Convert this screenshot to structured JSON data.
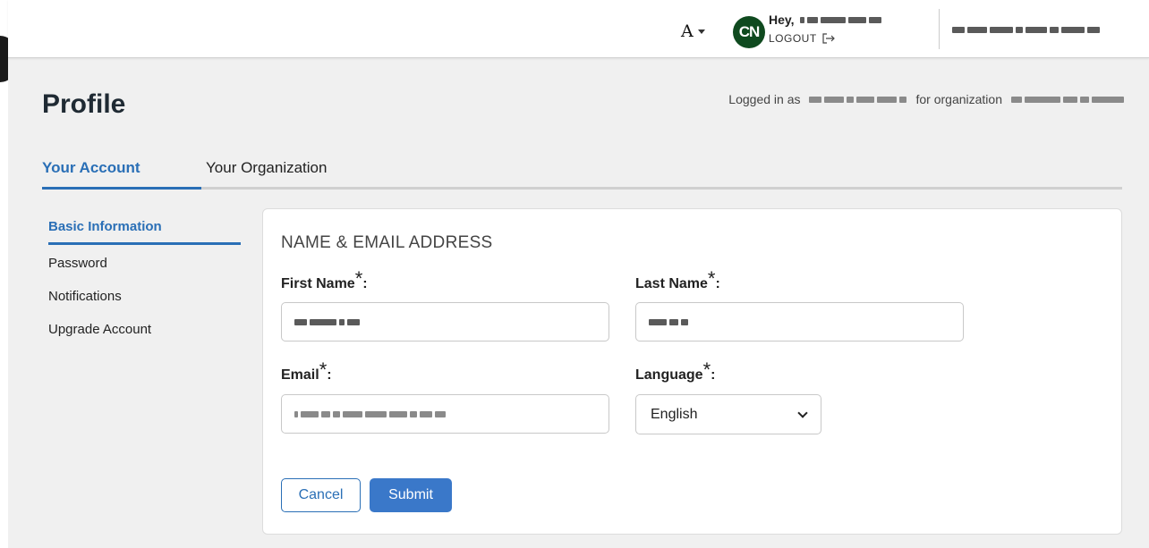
{
  "header": {
    "font_toggle": "A",
    "avatar_initials": "CN",
    "greeting": "Hey,",
    "logout": "LOGOUT"
  },
  "page": {
    "title": "Profile",
    "logged_in_prefix": "Logged in as",
    "for_org": "for organization"
  },
  "tabs": [
    {
      "label": "Your Account",
      "active": true
    },
    {
      "label": "Your Organization",
      "active": false
    }
  ],
  "sidenav": [
    {
      "label": "Basic Information",
      "active": true
    },
    {
      "label": "Password",
      "active": false
    },
    {
      "label": "Notifications",
      "active": false
    },
    {
      "label": "Upgrade Account",
      "active": false
    }
  ],
  "form": {
    "section_title": "NAME & EMAIL ADDRESS",
    "first_name_label": "First Name",
    "last_name_label": "Last Name",
    "email_label": "Email",
    "language_label": "Language",
    "required_mark": "*",
    "colon": ":",
    "language_value": "English",
    "cancel": "Cancel",
    "submit": "Submit"
  },
  "colors": {
    "accent": "#2a6fb6",
    "submit_bg": "#3a78c9",
    "avatar_bg": "#0f4a1f"
  }
}
